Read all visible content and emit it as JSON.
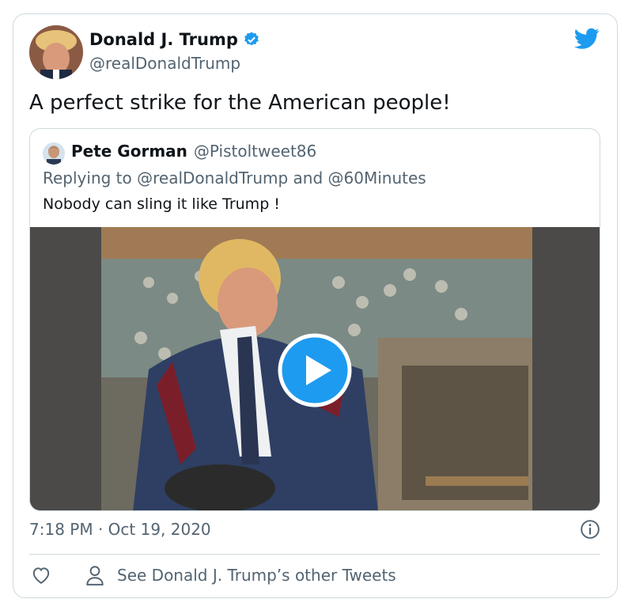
{
  "colors": {
    "twitter_blue": "#1d9bf0",
    "text_primary": "#0f1419",
    "text_secondary": "#536471",
    "border": "#cfd9de"
  },
  "tweet": {
    "author_name": "Donald J. Trump",
    "author_handle": "@realDonaldTrump",
    "verified": true,
    "text": "A perfect strike for the American people!",
    "timestamp": "7:18 PM · Oct 19, 2020"
  },
  "quoted_tweet": {
    "author_name": "Pete Gorman",
    "author_handle": "@Pistoltweet86",
    "replying_to": "Replying to @realDonaldTrump and @60Minutes",
    "text": "Nobody can sling it like Trump !",
    "media": "video"
  },
  "actions": {
    "see_other": "See Donald J. Trump’s other Tweets"
  },
  "icons": [
    "twitter-bird-icon",
    "verified-badge-icon",
    "play-icon",
    "info-icon",
    "heart-icon",
    "person-icon"
  ]
}
